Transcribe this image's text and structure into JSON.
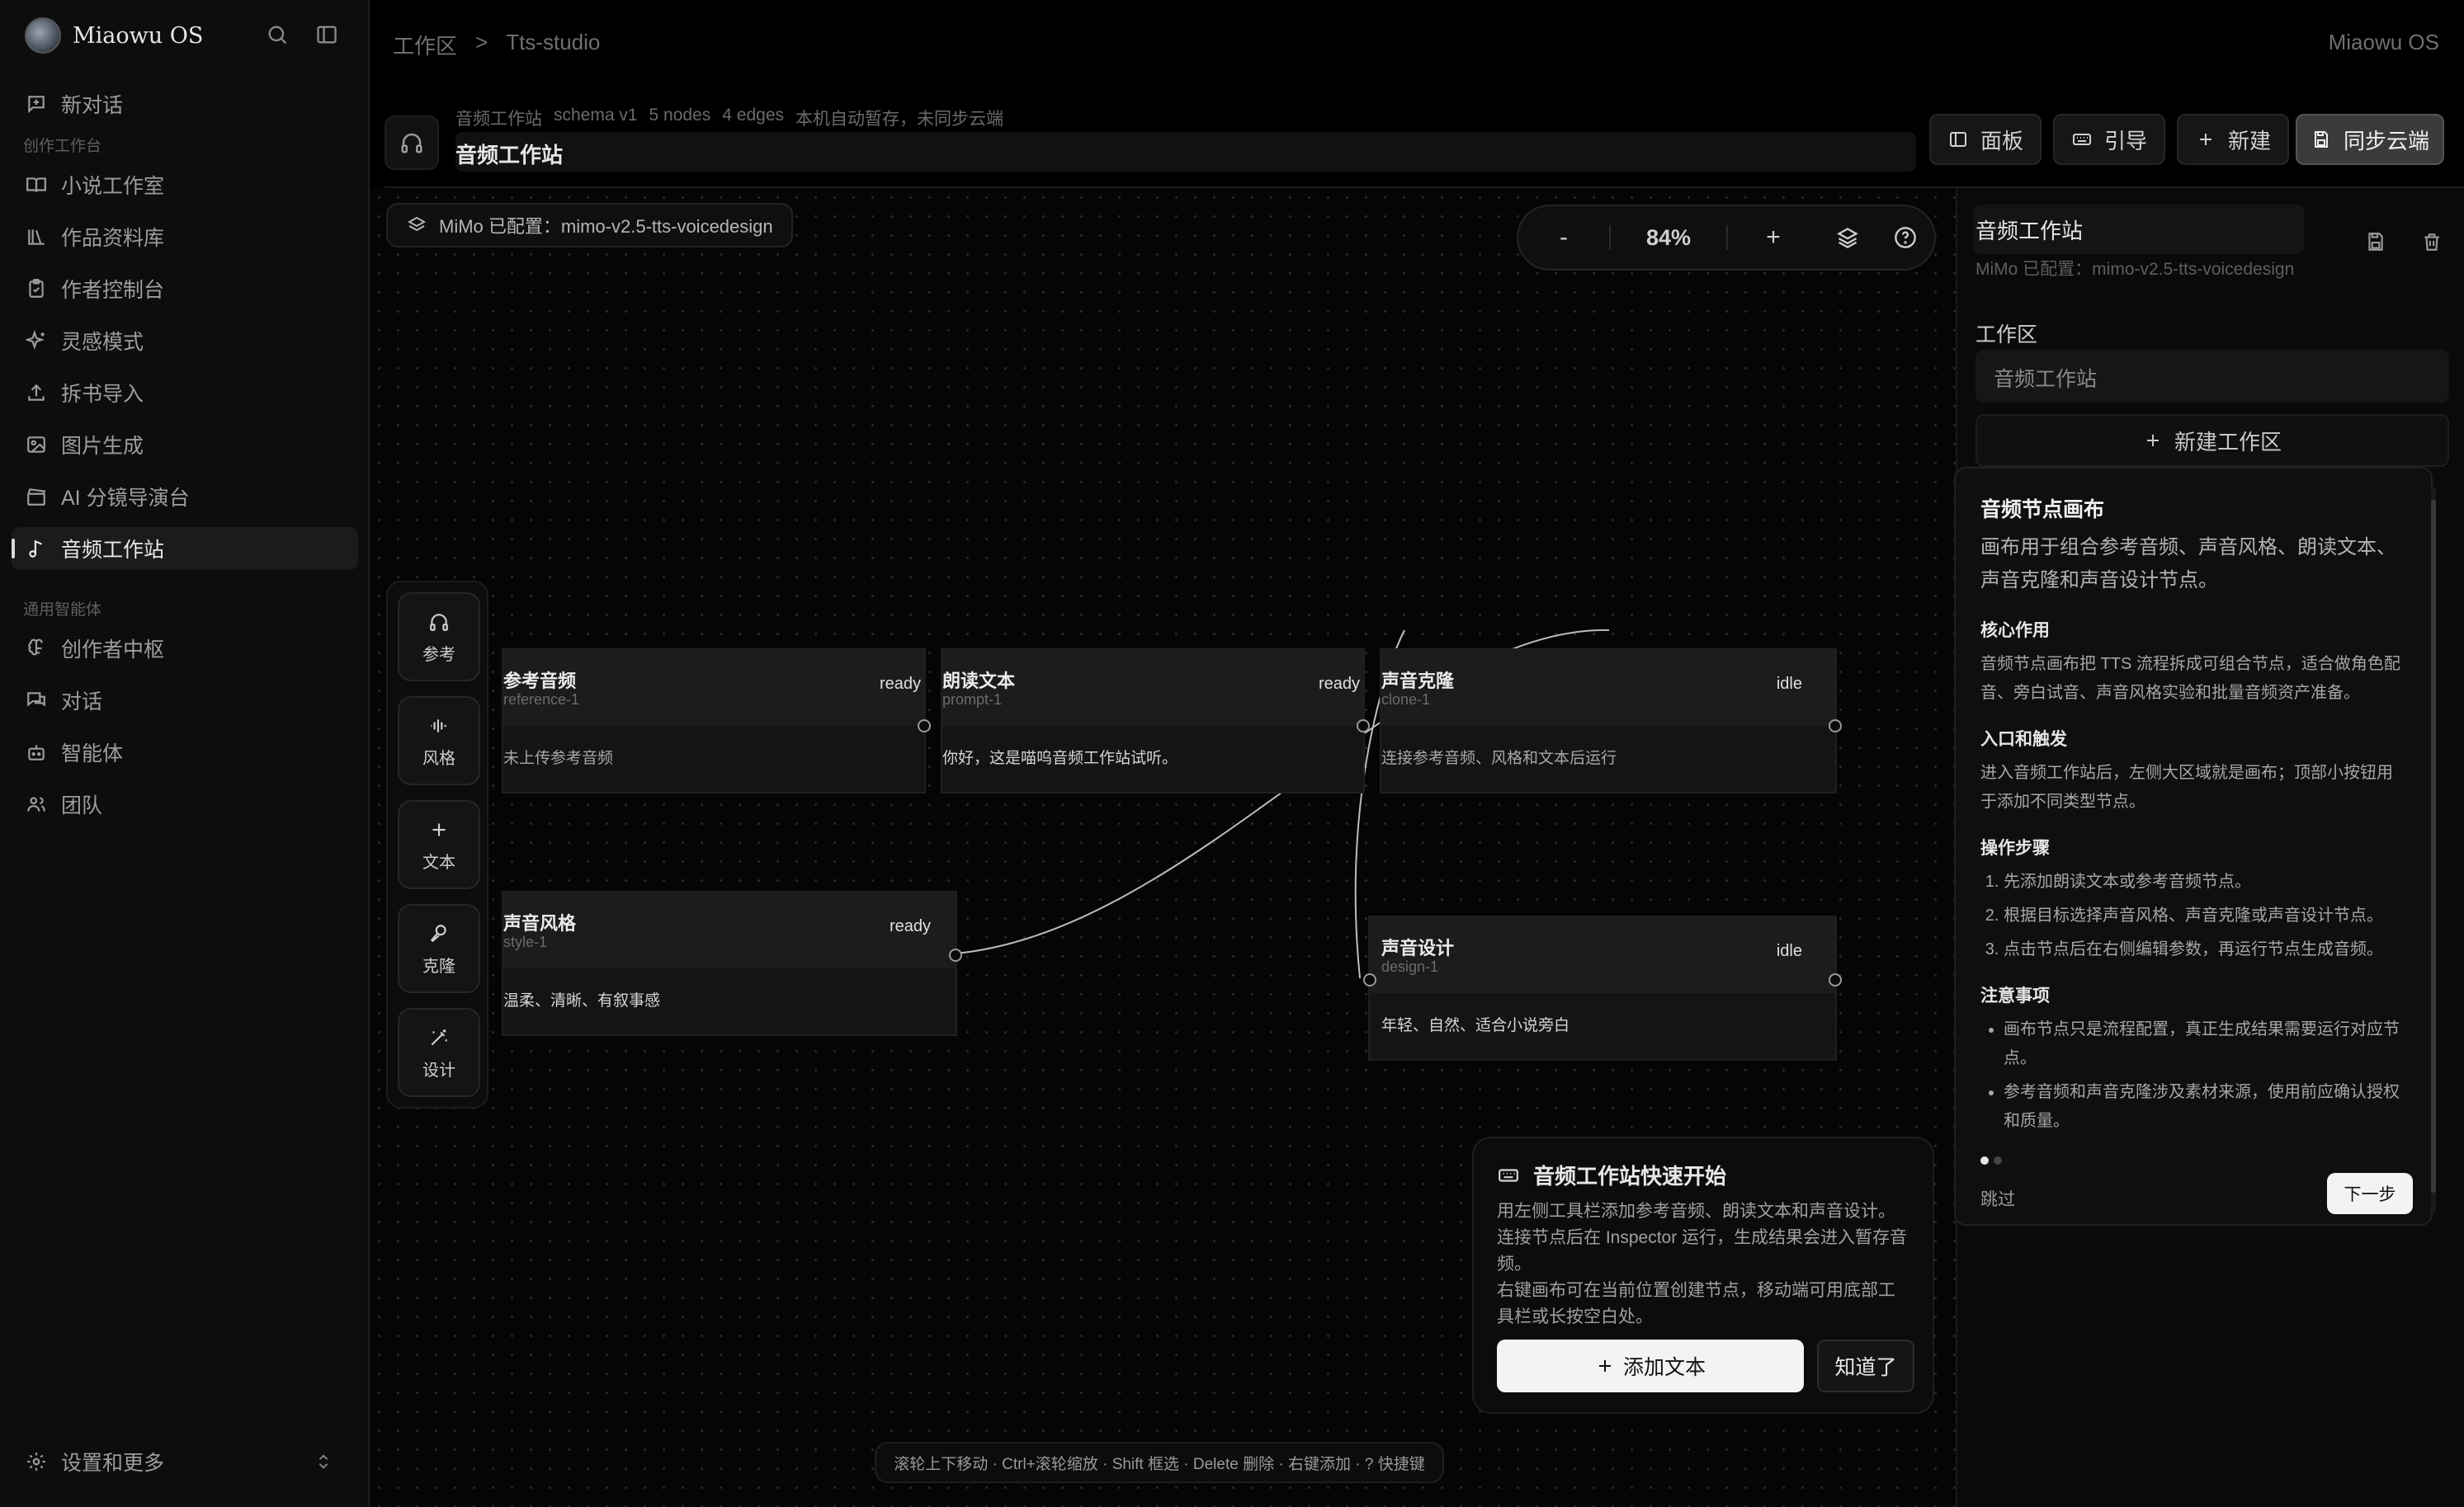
{
  "brand": {
    "name": "Miaowu OS"
  },
  "sidebar": {
    "new_chat": "新对话",
    "section_create": "创作工作台",
    "items": [
      {
        "label": "小说工作室"
      },
      {
        "label": "作品资料库"
      },
      {
        "label": "作者控制台"
      },
      {
        "label": "灵感模式"
      },
      {
        "label": "拆书导入"
      },
      {
        "label": "图片生成"
      },
      {
        "label": "AI 分镜导演台"
      },
      {
        "label": "音频工作站"
      }
    ],
    "section_agents": "通用智能体",
    "agent_items": [
      {
        "label": "创作者中枢"
      },
      {
        "label": "对话"
      },
      {
        "label": "智能体"
      },
      {
        "label": "团队"
      }
    ],
    "settings": "设置和更多"
  },
  "topbar": {
    "breadcrumb": [
      "工作区",
      ">",
      "Tts-studio"
    ],
    "right_title": "Miaowu OS"
  },
  "header": {
    "meta": [
      "音频工作站",
      "schema v1",
      "5 nodes",
      "4 edges",
      "本机自动暂存，未同步云端"
    ],
    "title": "音频工作站",
    "buttons": {
      "panel": "面板",
      "guide": "引导",
      "new": "新建",
      "sync": "同步云端"
    }
  },
  "canvas": {
    "config": "MiMo 已配置：mimo-v2.5-tts-voicedesign",
    "zoom": {
      "minus": "-",
      "value": "84%",
      "plus": "+"
    },
    "tools": [
      {
        "label": "参考"
      },
      {
        "label": "风格"
      },
      {
        "label": "文本"
      },
      {
        "label": "克隆"
      },
      {
        "label": "设计"
      }
    ],
    "nodes": {
      "reference": {
        "title": "参考音频",
        "id": "reference-1",
        "status": "ready",
        "body": "未上传参考音频"
      },
      "prompt": {
        "title": "朗读文本",
        "id": "prompt-1",
        "status": "ready",
        "body": "你好，这是喵呜音频工作站试听。"
      },
      "clone": {
        "title": "声音克隆",
        "id": "clone-1",
        "status": "idle",
        "body": "连接参考音频、风格和文本后运行"
      },
      "style": {
        "title": "声音风格",
        "id": "style-1",
        "status": "ready",
        "body": "温柔、清晰、有叙事感"
      },
      "design": {
        "title": "声音设计",
        "id": "design-1",
        "status": "idle",
        "body": "年轻、自然、适合小说旁白"
      }
    },
    "quickstart": {
      "title": "音频工作站快速开始",
      "lines": [
        "用左侧工具栏添加参考音频、朗读文本和声音设计。",
        "连接节点后在 Inspector 运行，生成结果会进入暂存音频。",
        "右键画布可在当前位置创建节点，移动端可用底部工具栏或长按空白处。"
      ],
      "add_text": "添加文本",
      "got_it": "知道了"
    },
    "hint": "滚轮上下移动 · Ctrl+滚轮缩放 · Shift 框选 · Delete 删除 · 右键添加 · ? 快捷键"
  },
  "inspector": {
    "title": "音频工作站",
    "subtitle": "MiMo 已配置：mimo-v2.5-tts-voicedesign",
    "workspace_label": "工作区",
    "workspace_value": "音频工作站",
    "new_workspace": "新建工作区",
    "guide": {
      "title": "音频节点画布",
      "lead": "画布用于组合参考音频、声音风格、朗读文本、声音克隆和声音设计节点。",
      "core_title": "核心作用",
      "core_text": "音频节点画布把 TTS 流程拆成可组合节点，适合做角色配音、旁白试音、声音风格实验和批量音频资产准备。",
      "entry_title": "入口和触发",
      "entry_text": "进入音频工作站后，左侧大区域就是画布；顶部小按钮用于添加不同类型节点。",
      "steps_title": "操作步骤",
      "steps": [
        "先添加朗读文本或参考音频节点。",
        "根据目标选择声音风格、声音克隆或声音设计节点。",
        "点击节点后在右侧编辑参数，再运行节点生成音频。"
      ],
      "notes_title": "注意事项",
      "notes": [
        "画布节点只是流程配置，真正生成结果需要运行对应节点。",
        "参考音频和声音克隆涉及素材来源，使用前应确认授权和质量。"
      ],
      "skip": "跳过",
      "next": "下一步"
    }
  }
}
